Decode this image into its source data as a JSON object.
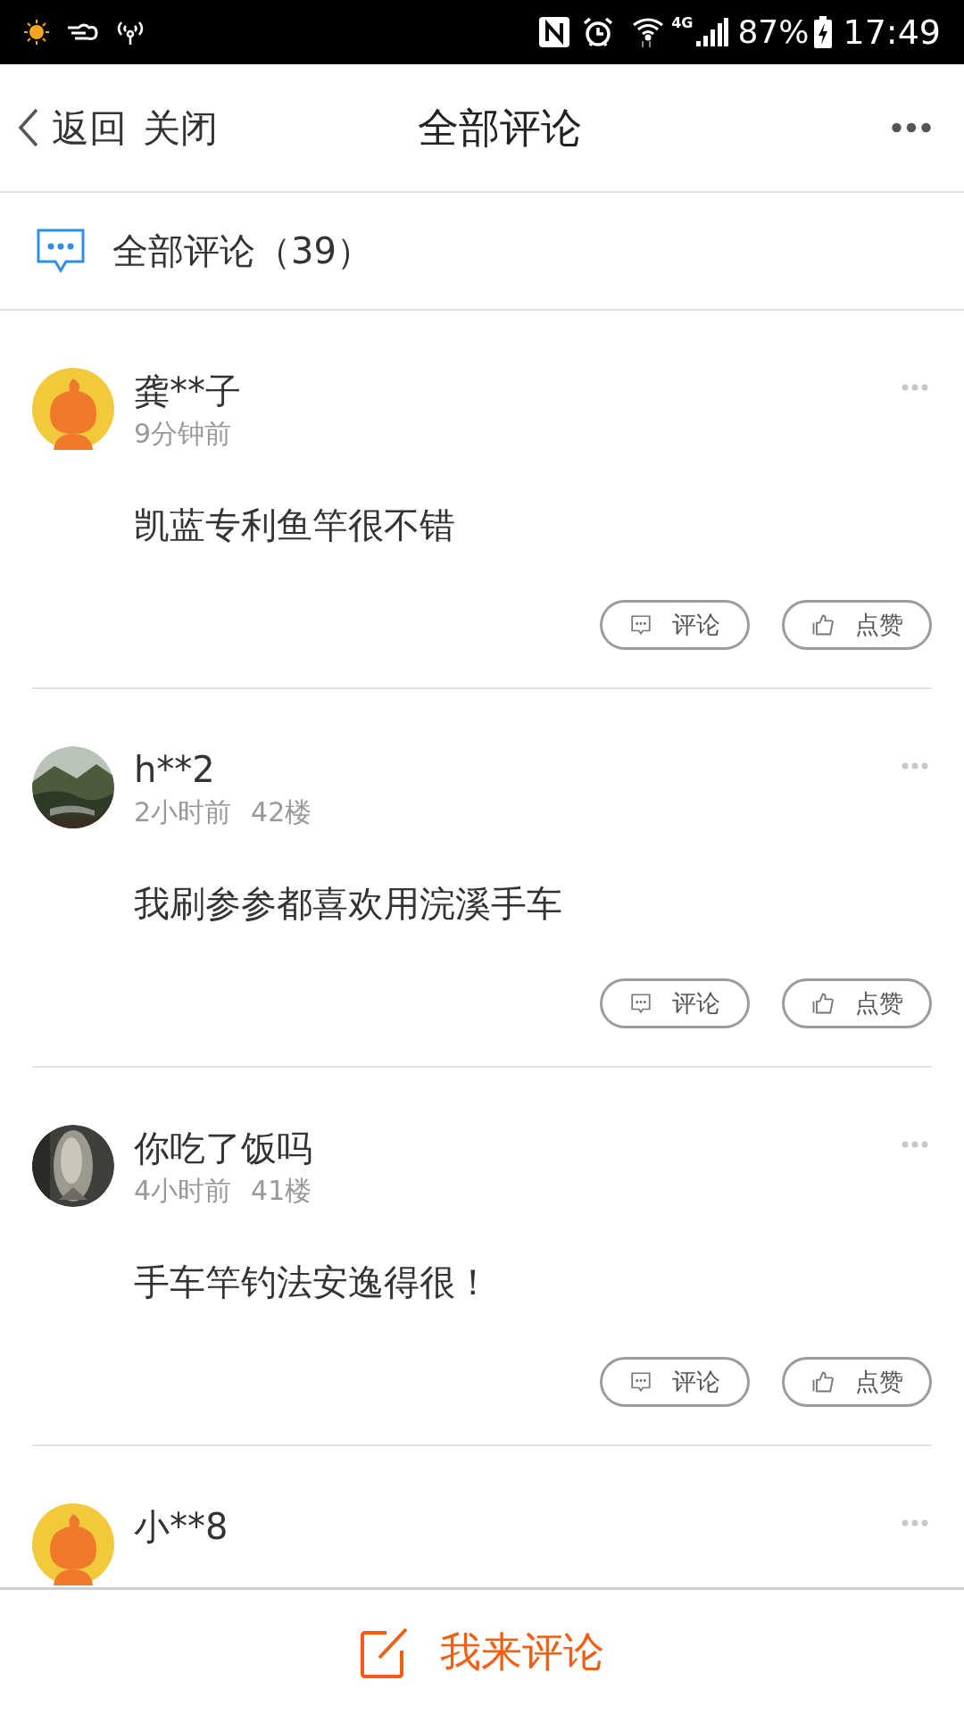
{
  "status_bar": {
    "network": "4G",
    "battery": "87%",
    "time": "17:49"
  },
  "header": {
    "back": "返回",
    "close": "关闭",
    "title": "全部评论"
  },
  "section": {
    "title": "全部评论（39）"
  },
  "comments": [
    {
      "avatar": {
        "kind": "mascot"
      },
      "name": "龚**子",
      "meta": [
        "9分钟前"
      ],
      "text": "凯蓝专利鱼竿很不错",
      "actions": [
        {
          "kind": "comment",
          "label": "评论"
        },
        {
          "kind": "like",
          "label": "点赞"
        }
      ]
    },
    {
      "avatar": {
        "kind": "landscape"
      },
      "name": "h**2",
      "meta": [
        "2小时前",
        "42楼"
      ],
      "text": "我刷参参都喜欢用浣溪手车",
      "actions": [
        {
          "kind": "comment",
          "label": "评论"
        },
        {
          "kind": "like",
          "label": "点赞"
        }
      ]
    },
    {
      "avatar": {
        "kind": "fish"
      },
      "name": "你吃了饭吗",
      "meta": [
        "4小时前",
        "41楼"
      ],
      "text": "手车竿钓法安逸得很！",
      "actions": [
        {
          "kind": "comment",
          "label": "评论"
        },
        {
          "kind": "like",
          "label": "点赞"
        }
      ]
    },
    {
      "avatar": {
        "kind": "mascot"
      },
      "name": "小**8"
    }
  ],
  "compose": {
    "label": "我来评论"
  }
}
